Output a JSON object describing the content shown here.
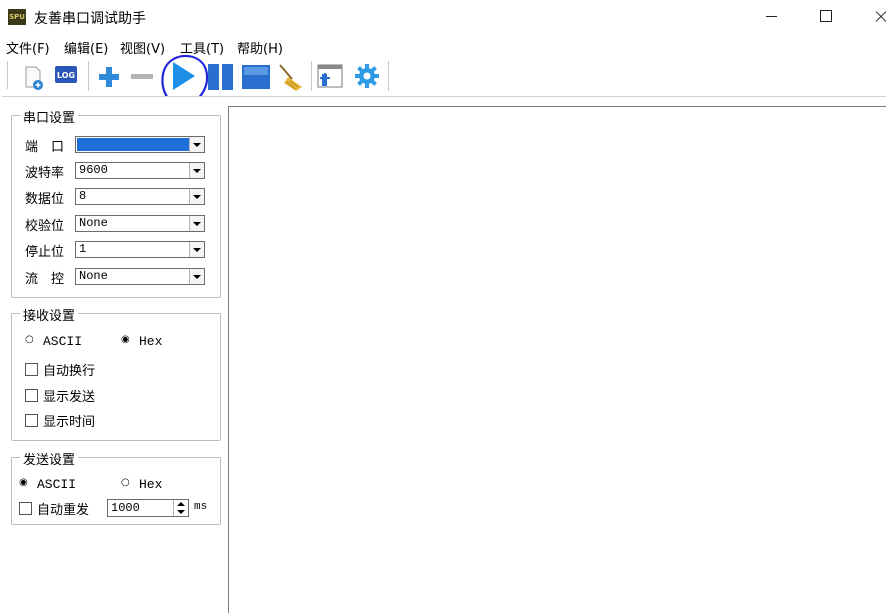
{
  "window": {
    "app_icon_text": "SPU",
    "title": "友善串口调试助手"
  },
  "menu": [
    {
      "label": "文件(F)"
    },
    {
      "label": "编辑(E)"
    },
    {
      "label": "视图(V)"
    },
    {
      "label": "工具(T)"
    },
    {
      "label": "帮助(H)"
    }
  ],
  "toolbar": {
    "log_label": "LOG",
    "colors": {
      "blue": "#2f8ad8",
      "play": "#1e8fe6",
      "gray": "#b4b4b4",
      "annotation": "#2323d8"
    }
  },
  "serial_settings": {
    "title": "串口设置",
    "rows": [
      {
        "label": "端　口",
        "value": ""
      },
      {
        "label": "波特率",
        "value": "9600"
      },
      {
        "label": "数据位",
        "value": "8"
      },
      {
        "label": "校验位",
        "value": "None"
      },
      {
        "label": "停止位",
        "value": "1"
      },
      {
        "label": "流　控",
        "value": "None"
      }
    ]
  },
  "receive_settings": {
    "title": "接收设置",
    "radio_ascii": "ASCII",
    "radio_hex": "Hex",
    "selected": "Hex",
    "checkboxes": [
      {
        "label": "自动换行",
        "checked": false
      },
      {
        "label": "显示发送",
        "checked": false
      },
      {
        "label": "显示时间",
        "checked": false
      }
    ]
  },
  "send_settings": {
    "title": "发送设置",
    "radio_ascii": "ASCII",
    "radio_hex": "Hex",
    "selected": "ASCII",
    "auto_resend_label": "自动重发",
    "auto_resend_checked": false,
    "interval_value": "1000",
    "interval_unit": "ms"
  }
}
